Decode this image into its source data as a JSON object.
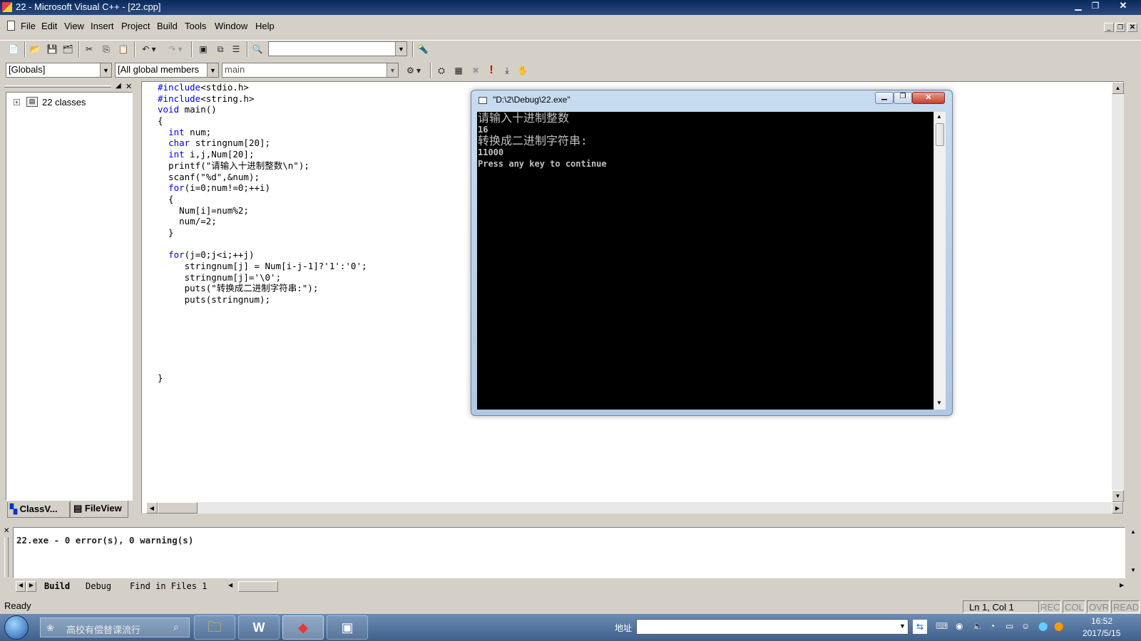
{
  "window": {
    "title": "22 - Microsoft Visual C++ - [22.cpp]"
  },
  "menu": [
    "File",
    "Edit",
    "View",
    "Insert",
    "Project",
    "Build",
    "Tools",
    "Window",
    "Help"
  ],
  "wizard_bar": {
    "scope": "[Globals]",
    "filter": "[All global members",
    "member": "main"
  },
  "workspace": {
    "tree_root": "22 classes",
    "tabs": [
      "ClassV...",
      "FileView"
    ]
  },
  "editor": {
    "lines": [
      "#include<stdio.h>",
      "#include<string.h>",
      "void main()",
      "{",
      "  int num;",
      "  char stringnum[20];",
      "  int i,j,Num[20];",
      "  printf(\"请输入十进制整数\\n\");",
      "  scanf(\"%d\",&num);",
      "  for(i=0;num!=0;++i)",
      "  {",
      "    Num[i]=num%2;",
      "    num/=2;",
      "  }",
      "",
      "  for(j=0;j<i;++j)",
      "     stringnum[j] = Num[i-j-1]?'1':'0';",
      "     stringnum[j]='\\0';",
      "     puts(\"转换成二进制字符串:\");",
      "     puts(stringnum);",
      "",
      "",
      "",
      "",
      "",
      "",
      "}"
    ]
  },
  "console": {
    "title": "\"D:\\2\\Debug\\22.exe\"",
    "lines": [
      "请输入十进制整数",
      "16",
      "转换成二进制字符串:",
      "11000",
      "Press any key to continue"
    ]
  },
  "output": {
    "text": "22.exe - 0 error(s), 0 warning(s)",
    "tabs": [
      "Build",
      "Debug",
      "Find in Files 1"
    ]
  },
  "statusbar": {
    "ready": "Ready",
    "position": "Ln 1, Col 1",
    "indicators": [
      "REC",
      "COL",
      "OVR",
      "READ"
    ]
  },
  "taskbar": {
    "search_placeholder": "高校有偿替课流行",
    "address_label": "地址",
    "time": "16:52",
    "date": "2017/5/15"
  }
}
